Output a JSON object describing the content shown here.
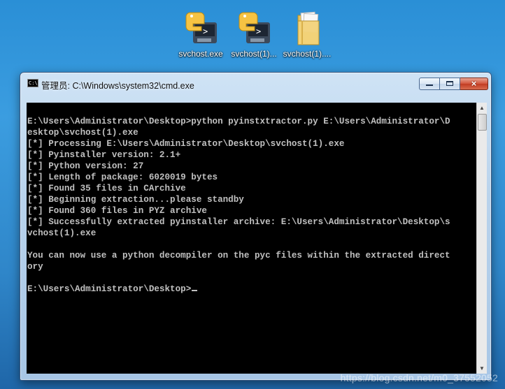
{
  "desktop": {
    "icons": [
      {
        "label": "svchost.exe",
        "icon": "python-exe-icon"
      },
      {
        "label": "svchost(1)...",
        "icon": "python-exe-icon"
      },
      {
        "label": "svchost(1)....",
        "icon": "folder-icon"
      }
    ]
  },
  "window": {
    "title": "管理员: C:\\Windows\\system32\\cmd.exe",
    "app_icon_text": "C:\\",
    "buttons": {
      "minimize": "minimize",
      "maximize": "maximize",
      "close": "×"
    }
  },
  "console": {
    "lines": [
      "",
      "E:\\Users\\Administrator\\Desktop>python pyinstxtractor.py E:\\Users\\Administrator\\D",
      "esktop\\svchost(1).exe",
      "[*] Processing E:\\Users\\Administrator\\Desktop\\svchost(1).exe",
      "[*] Pyinstaller version: 2.1+",
      "[*] Python version: 27",
      "[*] Length of package: 6020019 bytes",
      "[*] Found 35 files in CArchive",
      "[*] Beginning extraction...please standby",
      "[*] Found 360 files in PYZ archive",
      "[*] Successfully extracted pyinstaller archive: E:\\Users\\Administrator\\Desktop\\s",
      "vchost(1).exe",
      "",
      "You can now use a python decompiler on the pyc files within the extracted direct",
      "ory",
      "",
      "E:\\Users\\Administrator\\Desktop>"
    ]
  },
  "watermark": "https://blog.csdn.net/m0_37552052",
  "colors": {
    "console_bg": "#000000",
    "console_fg": "#c0c0c0",
    "close_button": "#c13c22"
  }
}
